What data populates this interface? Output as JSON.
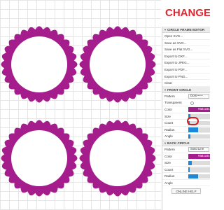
{
  "headline": "CHANGE S",
  "panel": {
    "circle_frame_editor": {
      "title": "CIRCLE FRAME EDITOR",
      "menu": [
        "Open SVG...",
        "Save as SVG...",
        "Save as Flat SVG...",
        "Export to DXF...",
        "Export to JPEG...",
        "Export to PDF...",
        "Export to PNG...",
        "Clear"
      ]
    },
    "front_circle": {
      "title": "FRONT CIRCLE",
      "pattern_label": "Pattern",
      "pattern_value": "Dots • • •",
      "transparent_label": "Transparent",
      "color_label": "Color",
      "color_value": "#a51c8c",
      "color_text": "#a51c8c",
      "size_label": "Size",
      "size_value": 0.1,
      "count_label": "Count",
      "count_value": 0.05,
      "radius_label": "Radius",
      "radius_value": 0.45,
      "angle_label": "Angle",
      "angle_value": 0.1
    },
    "back_circle": {
      "title": "BACK CIRCLE",
      "pattern_label": "Pattern",
      "pattern_value": "Solid Line",
      "color_label": "Color",
      "color_value": "#a51c8c",
      "color_text": "#a51c8c",
      "size_label": "Size",
      "size_value": 0.15,
      "count_label": "Count",
      "count_value": 0.05,
      "radius_label": "Radius",
      "radius_value": 0.45,
      "angle_label": "Angle",
      "angle_value": 0.1
    },
    "help_button": "ONLINE HELP"
  },
  "colors": {
    "frame": "#a51c8c",
    "headline": "#e0262e",
    "highlight": "#d31e1e",
    "slider": "#1e88d8"
  }
}
